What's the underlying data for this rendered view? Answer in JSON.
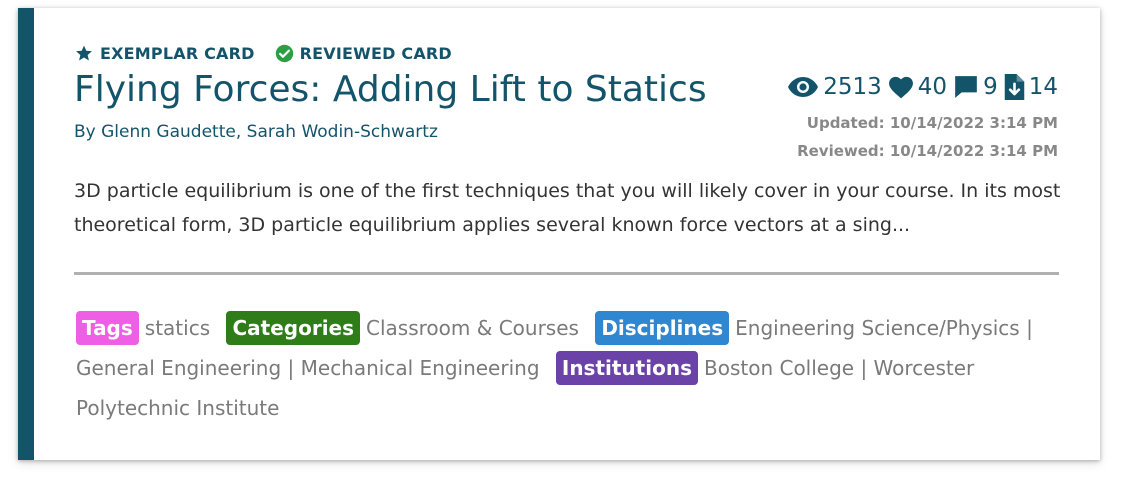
{
  "card": {
    "badges": {
      "exemplar": "EXEMPLAR CARD",
      "reviewed": "REVIEWED CARD"
    },
    "title": "Flying Forces: Adding Lift to Statics",
    "authors": "By Glenn Gaudette, Sarah Wodin-Schwartz",
    "stats": {
      "views": "2513",
      "likes": "40",
      "comments": "9",
      "downloads": "14"
    },
    "updated": "Updated: 10/14/2022 3:14 PM",
    "reviewed_date": "Reviewed: 10/14/2022 3:14 PM",
    "description": "3D particle equilibrium is one of the first techniques that you will likely cover in your course. In its most theoretical form, 3D particle equilibrium applies several known force vectors at a sing...",
    "taxonomy": {
      "tags_label": "Tags",
      "tags_value": "statics",
      "categories_label": "Categories",
      "categories_value": "Classroom & Courses",
      "disciplines_label": "Disciplines",
      "disciplines_value": "Engineering Science/Physics | General Engineering | Mechanical Engineering",
      "institutions_label": "Institutions",
      "institutions_value": "Boston College | Worcester Polytechnic Institute"
    }
  },
  "colors": {
    "accent": "#14546b",
    "tags": "#ee5fe6",
    "categories": "#2e7d18",
    "disciplines": "#2f86d1",
    "institutions": "#6b42a8",
    "reviewed_check": "#2e9e44"
  },
  "icons": {
    "exemplar": "star-icon",
    "reviewed": "check-circle-icon",
    "views": "eye-icon",
    "likes": "heart-icon",
    "comments": "comment-icon",
    "downloads": "file-download-icon"
  }
}
